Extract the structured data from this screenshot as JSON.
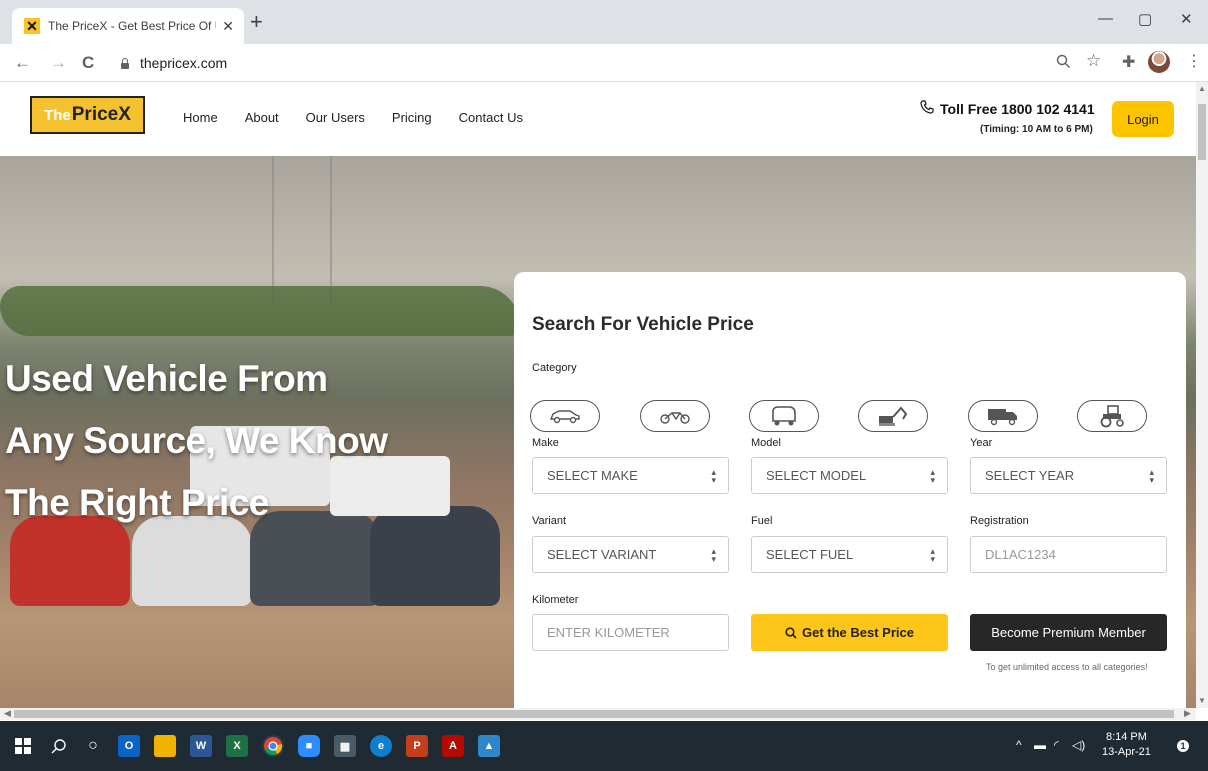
{
  "browser": {
    "tab_title": "The PriceX - Get Best Price Of Us",
    "new_tab": "+",
    "url": "thepricex.com",
    "back": "←",
    "forward": "→",
    "reload": "C",
    "minimize": "—",
    "maximize": "▢",
    "close": "✕"
  },
  "header": {
    "logo_the": "The",
    "logo_pricex": "PriceX",
    "nav": [
      "Home",
      "About",
      "Our Users",
      "Pricing",
      "Contact Us"
    ],
    "toll_free": "Toll Free 1800 102 4141",
    "timing": "(Timing: 10 AM to 6 PM)",
    "login": "Login"
  },
  "hero": {
    "line1": "Used Vehicle From",
    "line2": "Any Source, We Know",
    "line3": "The Right Price"
  },
  "search": {
    "title": "Search For Vehicle Price",
    "category_label": "Category",
    "categories": [
      "car-icon",
      "bike-icon",
      "auto-rickshaw-icon",
      "construction-icon",
      "truck-icon",
      "tractor-icon"
    ],
    "make_label": "Make",
    "make_value": "SELECT MAKE",
    "model_label": "Model",
    "model_value": "SELECT MODEL",
    "year_label": "Year",
    "year_value": "SELECT YEAR",
    "variant_label": "Variant",
    "variant_value": "SELECT VARIANT",
    "fuel_label": "Fuel",
    "fuel_value": "SELECT FUEL",
    "registration_label": "Registration",
    "registration_placeholder": "DL1AC1234",
    "kilometer_label": "Kilometer",
    "kilometer_placeholder": "ENTER KILOMETER",
    "best_price_button": "Get the Best Price",
    "premium_button": "Become Premium Member",
    "premium_note": "To get unlimited access to all categories!"
  },
  "taskbar": {
    "time": "8:14 PM",
    "date": "13-Apr-21",
    "notification_count": "1"
  },
  "colors": {
    "brand_yellow": "#ffc61a",
    "dark_button": "#272727",
    "chat_green": "#1bbf1b"
  }
}
